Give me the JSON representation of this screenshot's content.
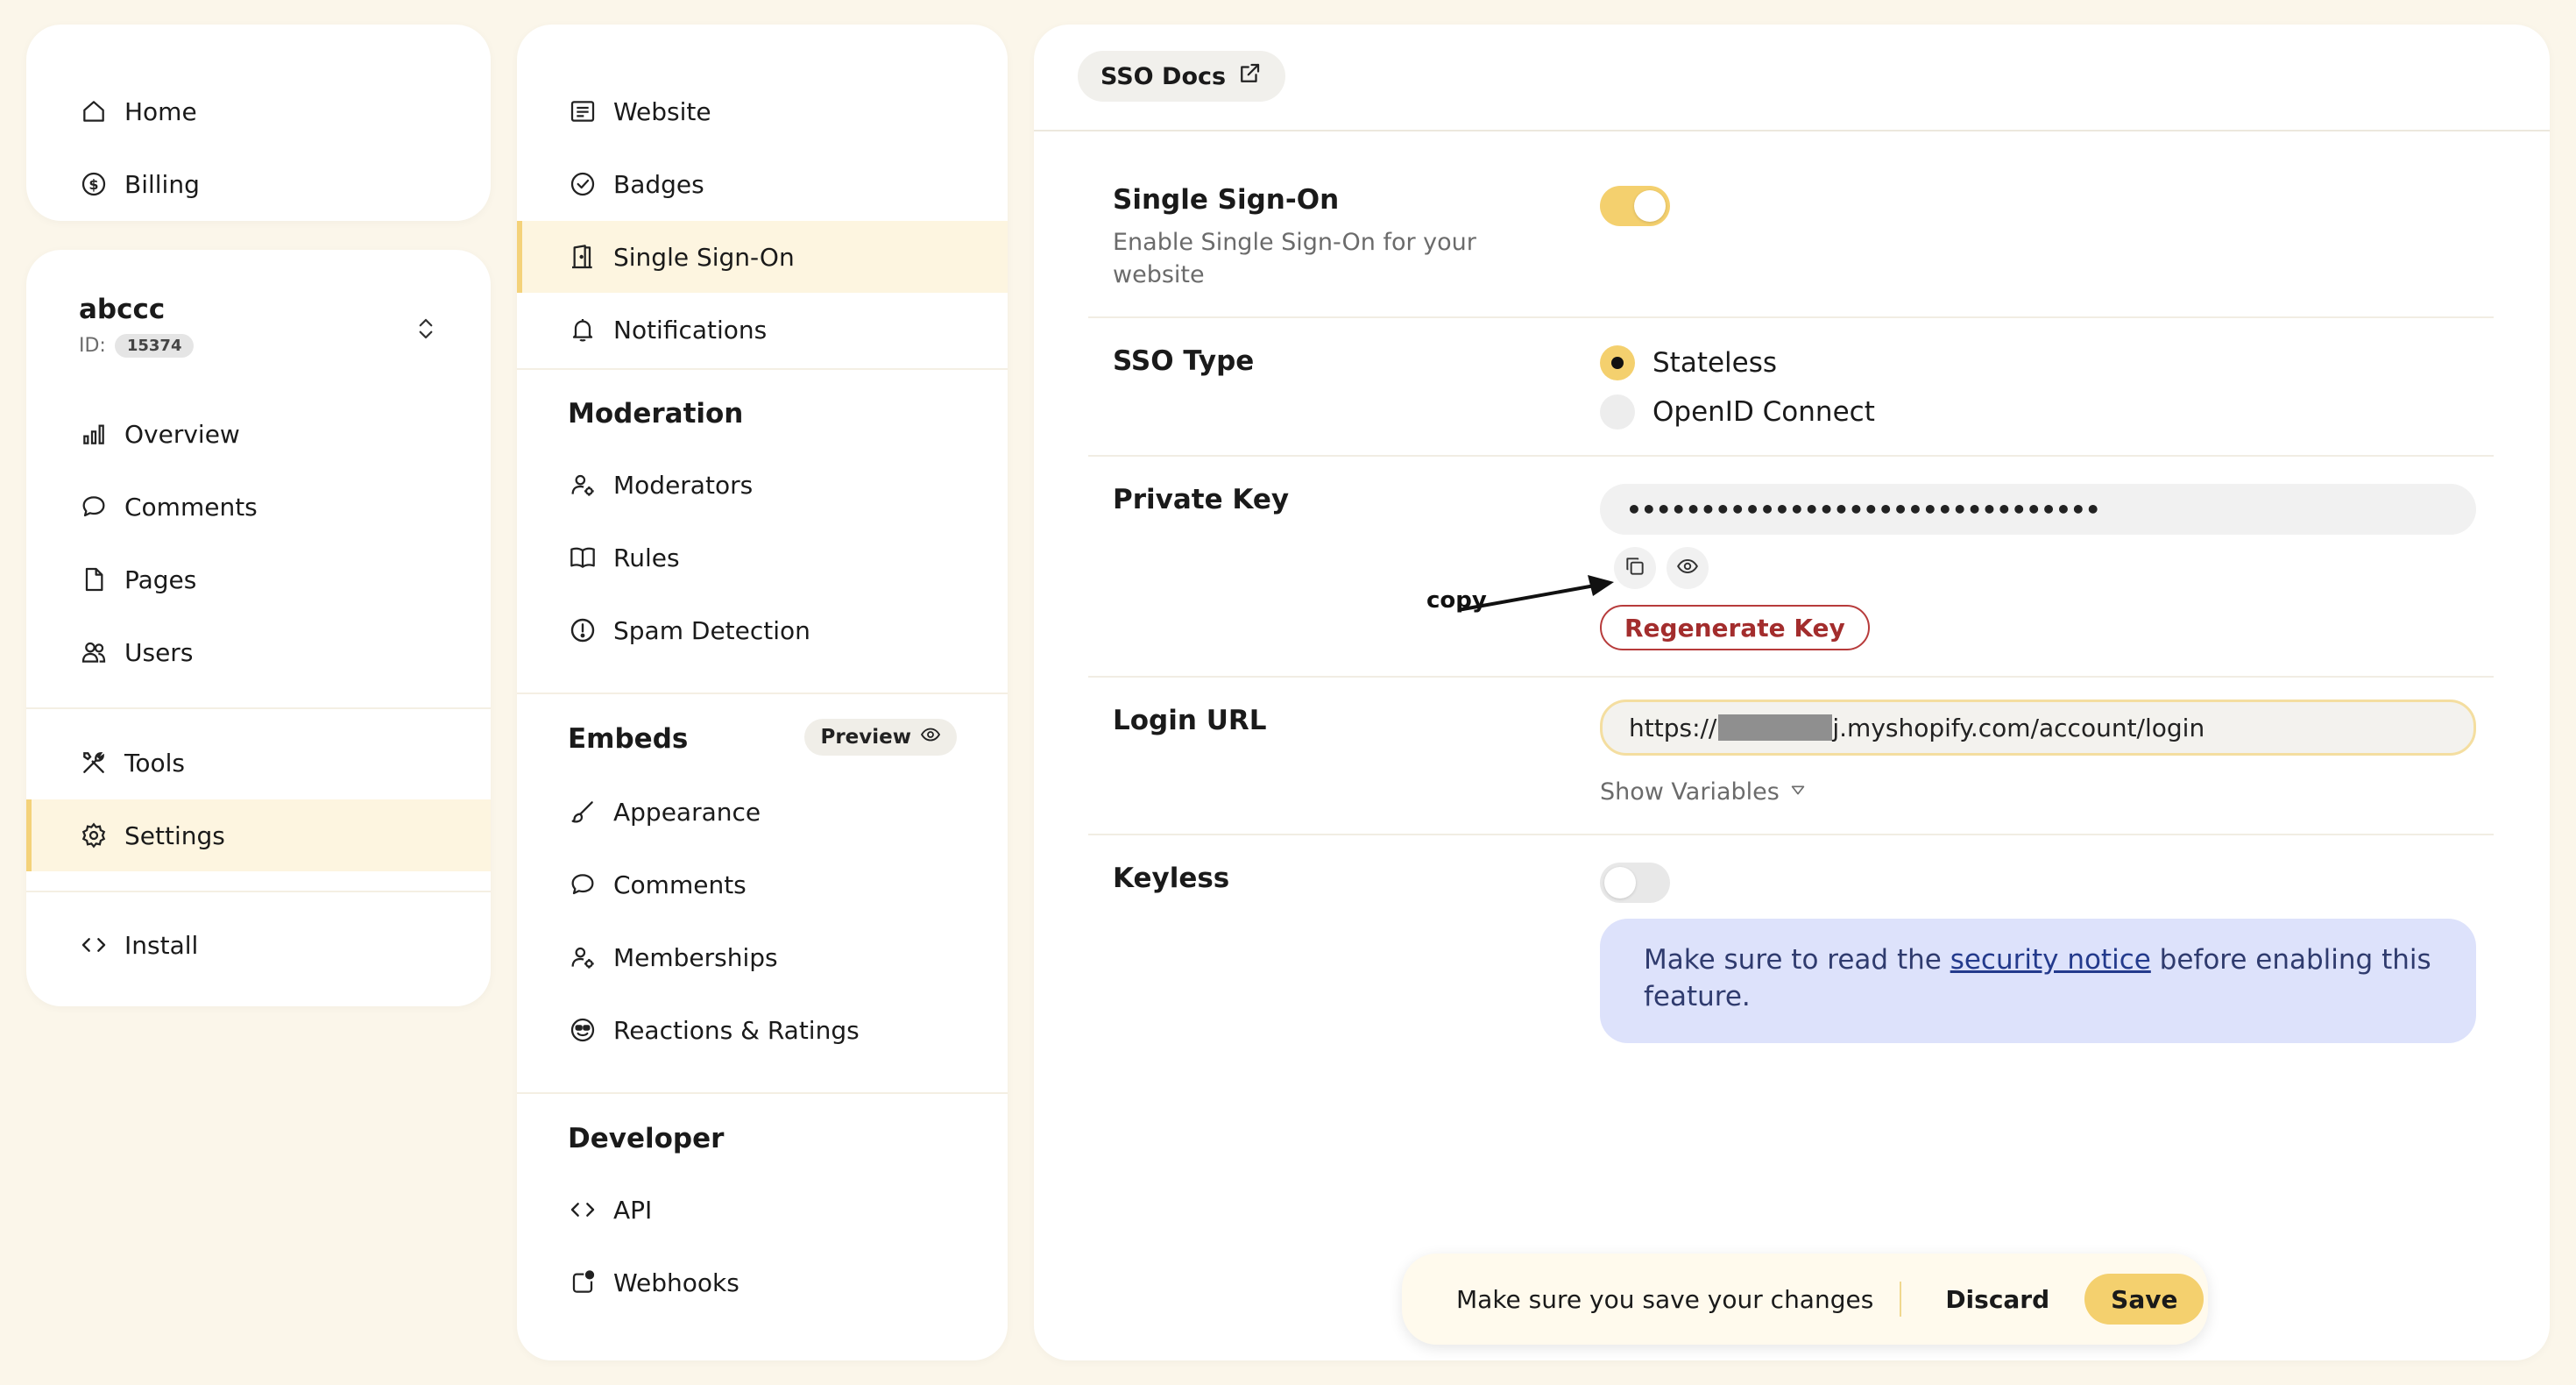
{
  "top_nav": [
    {
      "label": "Home",
      "icon": "home-icon"
    },
    {
      "label": "Billing",
      "icon": "dollar-icon"
    }
  ],
  "site": {
    "name": "abccc",
    "id_label": "ID:",
    "id_value": "15374"
  },
  "site_nav": [
    {
      "label": "Overview",
      "icon": "bar-chart-icon"
    },
    {
      "label": "Comments",
      "icon": "comment-icon"
    },
    {
      "label": "Pages",
      "icon": "page-icon"
    },
    {
      "label": "Users",
      "icon": "users-icon"
    },
    {
      "label": "Tools",
      "icon": "tools-icon"
    },
    {
      "label": "Settings",
      "icon": "gear-icon",
      "active": true
    },
    {
      "label": "Install",
      "icon": "code-icon"
    }
  ],
  "menu": {
    "general": [
      {
        "label": "Website",
        "icon": "website-icon"
      },
      {
        "label": "Badges",
        "icon": "badge-icon"
      },
      {
        "label": "Single Sign-On",
        "icon": "door-icon",
        "active": true
      },
      {
        "label": "Notifications",
        "icon": "bell-icon"
      }
    ],
    "moderation_title": "Moderation",
    "moderation": [
      {
        "label": "Moderators",
        "icon": "moderator-icon"
      },
      {
        "label": "Rules",
        "icon": "book-icon"
      },
      {
        "label": "Spam Detection",
        "icon": "alert-icon"
      }
    ],
    "embeds_title": "Embeds",
    "embeds_preview": "Preview",
    "embeds": [
      {
        "label": "Appearance",
        "icon": "brush-icon"
      },
      {
        "label": "Comments",
        "icon": "comment-icon"
      },
      {
        "label": "Memberships",
        "icon": "membership-icon"
      },
      {
        "label": "Reactions & Ratings",
        "icon": "smiley-icon"
      }
    ],
    "developer_title": "Developer",
    "developer": [
      {
        "label": "API",
        "icon": "code-icon"
      },
      {
        "label": "Webhooks",
        "icon": "webhook-icon"
      }
    ]
  },
  "main": {
    "docs_label": "SSO Docs",
    "sso": {
      "title": "Single Sign-On",
      "desc": "Enable Single Sign-On for your website",
      "enabled": true
    },
    "sso_type": {
      "title": "SSO Type",
      "options": [
        "Stateless",
        "OpenID Connect"
      ],
      "selected": "Stateless"
    },
    "private_key": {
      "title": "Private Key",
      "value": "••••••••••••••••••••••••••••••••",
      "copy_note": "copy",
      "regenerate_label": "Regenerate Key"
    },
    "login_url": {
      "title": "Login URL",
      "prefix": "https://",
      "suffix": "j.myshopify.com/account/login",
      "show_variables": "Show Variables"
    },
    "keyless": {
      "title": "Keyless",
      "enabled": false,
      "notice_before": "Make sure to read the ",
      "notice_link": "security notice",
      "notice_after": " before enabling this feature."
    }
  },
  "savebar": {
    "message": "Make sure you save your changes",
    "discard": "Discard",
    "save": "Save"
  },
  "colors": {
    "background": "#fbf6ea",
    "accent": "#f4d06e",
    "danger": "#a32d2d",
    "notice_bg": "#dde2fb"
  }
}
